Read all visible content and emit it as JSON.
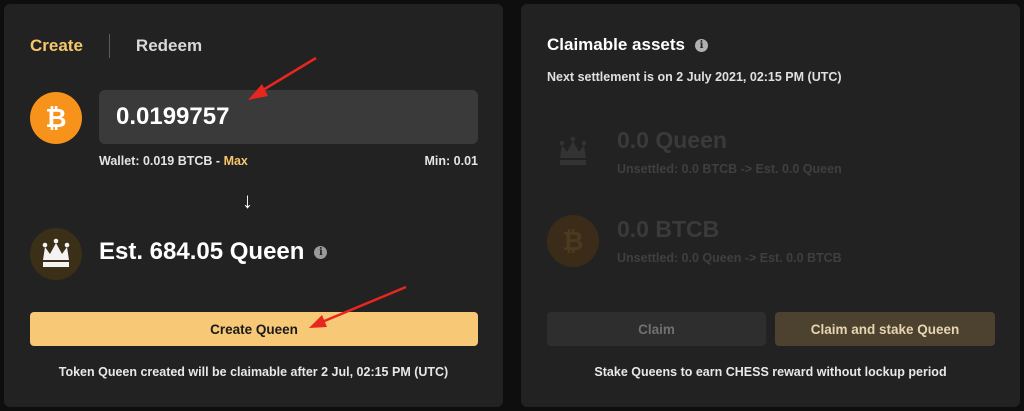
{
  "create_panel": {
    "tabs": [
      {
        "label": "Create",
        "active": true
      },
      {
        "label": "Redeem",
        "active": false
      }
    ],
    "input_value": "0.0199757",
    "btc_icon_glyph": "₿",
    "wallet_label": "Wallet: 0.019 BTCB - ",
    "max_label": "Max",
    "min_label": "Min: 0.01",
    "arrow_glyph": "↓",
    "estimate": "Est. 684.05 Queen",
    "create_button": "Create Queen",
    "footer_note": "Token Queen created will be claimable after 2 Jul, 02:15 PM (UTC)"
  },
  "claim_panel": {
    "title": "Claimable assets",
    "settlement": "Next settlement is on 2 July 2021, 02:15 PM (UTC)",
    "assets": [
      {
        "icon": "queen-icon",
        "amount": "0.0 Queen",
        "sub": "Unsettled: 0.0 BTCB -> Est. 0.0 Queen"
      },
      {
        "icon": "bitcoin-icon",
        "amount": "0.0 BTCB",
        "sub": "Unsettled: 0.0 Queen -> Est. 0.0 BTCB"
      }
    ],
    "claim_button": "Claim",
    "claim_stake_button": "Claim and stake Queen",
    "footer_note": "Stake Queens to earn CHESS reward without lockup period"
  },
  "info_glyph": "i",
  "colors": {
    "accent": "#f5c66b",
    "button": "#f7c875",
    "bitcoin": "#f7931a",
    "panel": "#222222",
    "annotation": "#e8261f"
  }
}
